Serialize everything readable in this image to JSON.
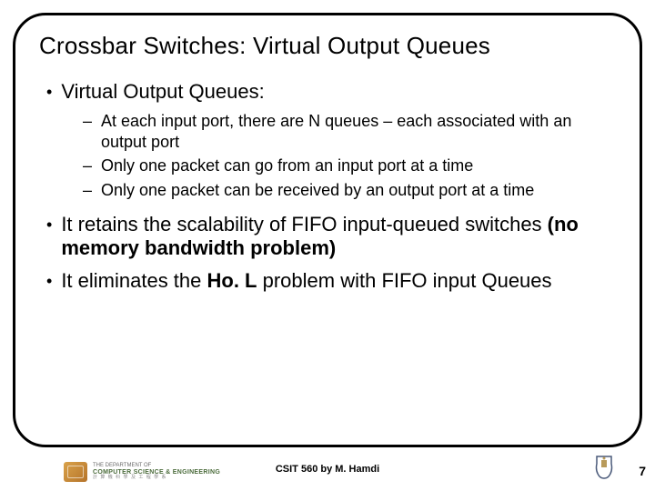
{
  "title": "Crossbar Switches: Virtual Output Queues",
  "bullets": {
    "b1": "Virtual Output Queues:",
    "b1_sub": {
      "s1": "At each input port, there are N queues – each associated with an output port",
      "s2": "Only one packet can go from an input port at a time",
      "s3": "Only one packet can be received by an output port at a time"
    },
    "b2_pre": "It retains the scalability of FIFO input-queued switches ",
    "b2_bold": "(no memory bandwidth problem)",
    "b3_pre": "It eliminates the ",
    "b3_bold": "Ho. L",
    "b3_post": " problem with FIFO input Queues"
  },
  "footer": {
    "dept_line1": "THE DEPARTMENT OF",
    "dept_line2": "COMPUTER SCIENCE & ENGINEERING",
    "dept_line3": "計 算 機 科 學 及 工 程 學 系",
    "center": "CSIT 560 by M. Hamdi",
    "page": "7"
  }
}
